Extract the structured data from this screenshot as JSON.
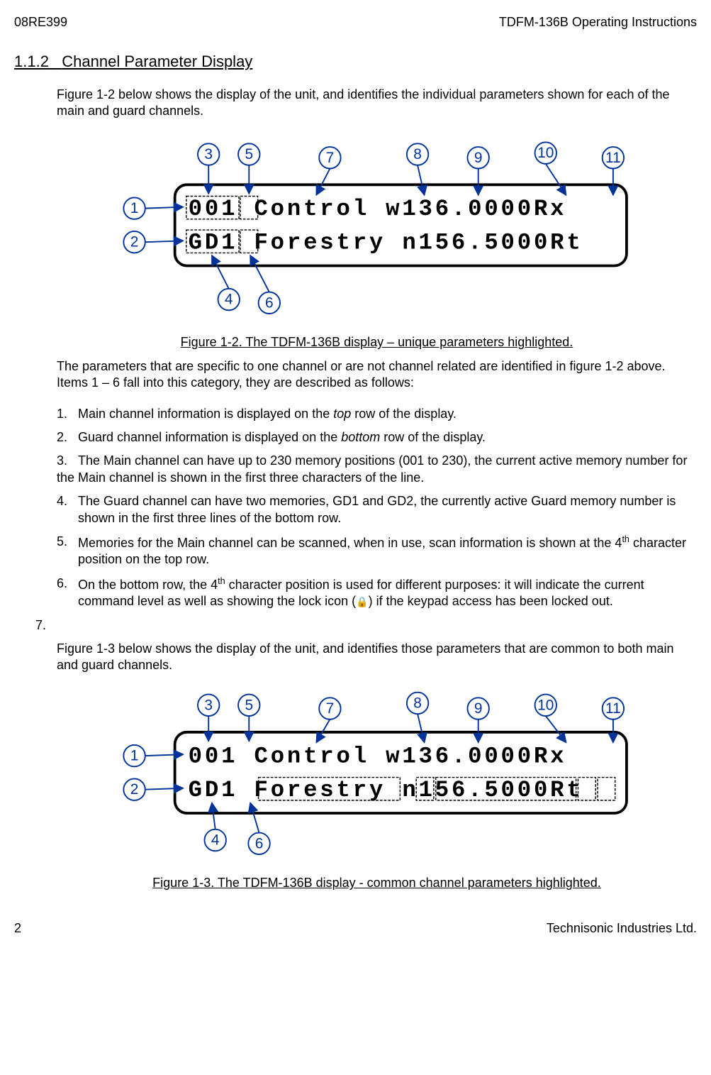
{
  "header": {
    "left": "08RE399",
    "right": "TDFM-136B Operating Instructions"
  },
  "section": {
    "number": "1.1.2",
    "title": "Channel Parameter Display"
  },
  "intro1": "Figure 1-2 below shows the display of the unit, and identifies the individual parameters shown for each of the main and guard channels.",
  "fig1": {
    "caption": "Figure 1-2. The TDFM-136B display – unique parameters highlighted.",
    "lcd_line1": "001 Control  w136.0000Rx",
    "lcd_line2": "GD1 Forestry n156.5000Rt",
    "callouts": [
      "1",
      "2",
      "3",
      "4",
      "5",
      "6",
      "7",
      "8",
      "9",
      "10",
      "11"
    ]
  },
  "para2": "The parameters that are specific to one channel or are not channel related are identified in figure 1-2 above.  Items 1 – 6 fall into this category, they are described as follows:",
  "items": {
    "i1_num": "1.",
    "i1_a": "Main channel information is displayed on the ",
    "i1_b": "top",
    "i1_c": " row of the display.",
    "i2_num": "2.",
    "i2_a": "Guard channel information is displayed on the ",
    "i2_b": "bottom",
    "i2_c": " row of the display.",
    "i3_num": "3.",
    "i3_text": "The Main channel can have up to 230 memory positions (001 to 230), the current active memory number for the Main channel is shown in the first three characters of the line.",
    "i4_num": "4.",
    "i4_text": "The Guard channel can have two memories, GD1 and GD2, the currently active Guard memory number is shown in the first three lines of the bottom row.",
    "i5_num": "5.",
    "i5_a": "Memories for the Main channel can be scanned, when in use, scan information is shown at the 4",
    "i5_sup": "th",
    "i5_b": " character position on the top row.",
    "i6_num": "6.",
    "i6_a": "On the bottom row, the 4",
    "i6_sup": "th",
    "i6_b": " character position is used for different purposes: it will indicate the current command level as well as showing the lock icon (",
    "i6_c": ") if the keypad access has been locked out.",
    "i7_num": "7."
  },
  "para3": "Figure 1-3 below shows the display of the unit, and identifies those parameters that are common to both main and guard channels.",
  "fig2": {
    "caption": "Figure 1-3. The TDFM-136B display - common channel parameters highlighted.",
    "lcd_line1": "001 Control  w136.0000Rx",
    "lcd_line2": "GD1 Forestry n156.5000Rt",
    "callouts": [
      "1",
      "2",
      "3",
      "4",
      "5",
      "6",
      "7",
      "8",
      "9",
      "10",
      "11"
    ]
  },
  "footer": {
    "left": "2",
    "right": "Technisonic Industries Ltd."
  }
}
